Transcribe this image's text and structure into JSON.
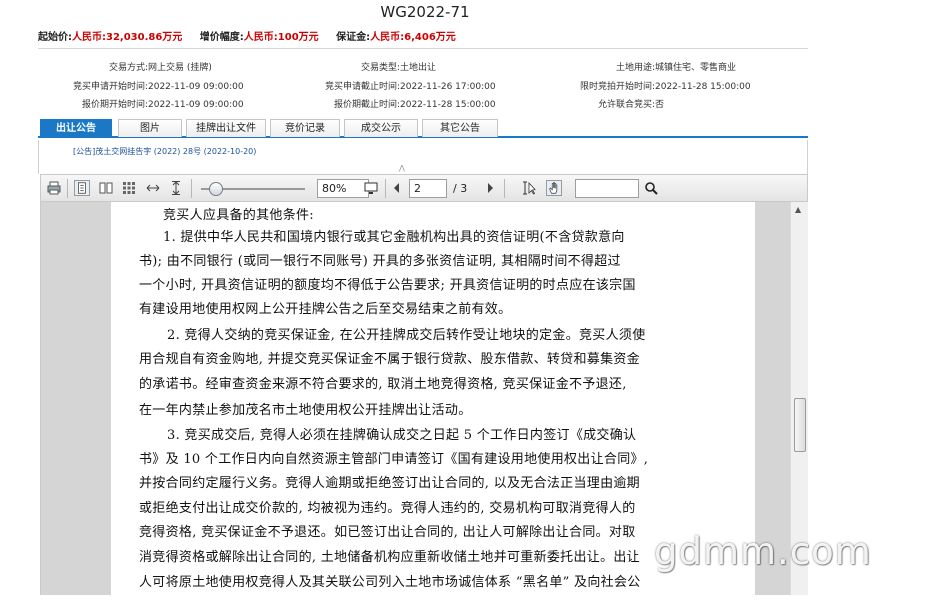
{
  "header": {
    "title": "WG2022-71"
  },
  "prices": {
    "start_label": "起始价:",
    "start_value": "人民币:32,030.86万元",
    "increment_label": "增价幅度:",
    "increment_value": "人民币:100万元",
    "deposit_label": "保证金:",
    "deposit_value": "人民币:6,406万元"
  },
  "info": {
    "r1": {
      "c1_label": "交易方式:",
      "c1_value": "网上交易 (挂牌)",
      "c2_label": "交易类型:",
      "c2_value": "土地出让",
      "c3_label": "土地用途:",
      "c3_value": "城镇住宅、零售商业"
    },
    "r2": {
      "c1_label": "竞买申请开始时间:",
      "c1_value": "2022-11-09 09:00:00",
      "c2_label": "竞买申请截止时间:",
      "c2_value": "2022-11-26 17:00:00",
      "c3_label": "限时竞拍开始时间:",
      "c3_value": "2022-11-28 15:00:00"
    },
    "r3": {
      "c1_label": "报价期开始时间:",
      "c1_value": "2022-11-09 09:00:00",
      "c2_label": "报价期截止时间:",
      "c2_value": "2022-11-28 15:00:00",
      "c3_label": "允许联合竞买:",
      "c3_value": "否"
    }
  },
  "tabs": [
    "出让公告",
    "图片",
    "挂牌出让文件",
    "竞价记录",
    "成交公示",
    "其它公告"
  ],
  "notice": {
    "link": "[公告]茂土交网挂告字 (2022) 28号 (2022-10-20)"
  },
  "toolbar": {
    "zoom": "80%",
    "page": "2",
    "page_total": "/ 3",
    "search_value": ""
  },
  "document": {
    "lines": [
      "竞买人应具备的其他条件:",
      "1. 提供中华人民共和国境内银行或其它金融机构出具的资信证明(不含贷款意向",
      "书); 由不同银行 (或同一银行不同账号) 开具的多张资信证明, 其相隔时间不得超过",
      "一个小时, 开具资信证明的额度均不得低于公告要求; 开具资信证明的时点应在该宗国",
      "有建设用地使用权网上公开挂牌公告之后至交易结束之前有效。",
      "2. 竞得人交纳的竞买保证金, 在公开挂牌成交后转作受让地块的定金。竞买人须使",
      "用合规自有资金购地, 并提交竞买保证金不属于银行贷款、股东借款、转贷和募集资金",
      "的承诺书。经审查资金来源不符合要求的, 取消土地竞得资格, 竞买保证金不予退还,",
      "在一年内禁止参加茂名市土地使用权公开挂牌出让活动。",
      "3. 竞买成交后, 竞得人必须在挂牌确认成交之日起 5 个工作日内签订《成交确认",
      "书》及 10 个工作日内向自然资源主管部门申请签订《国有建设用地使用权出让合同》,",
      "并按合同约定履行义务。竞得人逾期或拒绝签订出让合同的, 以及无合法正当理由逾期",
      "或拒绝支付出让成交价款的, 均被视为违约。竞得人违约的, 交易机构可取消竞得人的",
      "竞得资格, 竞买保证金不予退还。如已签订出让合同的, 出让人可解除出让合同。对取",
      "消竞得资格或解除出让合同的, 土地储备机构应重新收储土地并可重新委托出让。出让",
      "人可将原土地使用权竞得人及其关联公司列入土地市场诚信体系 “黑名单” 及向社会公"
    ]
  },
  "watermark": "gdmm.com"
}
